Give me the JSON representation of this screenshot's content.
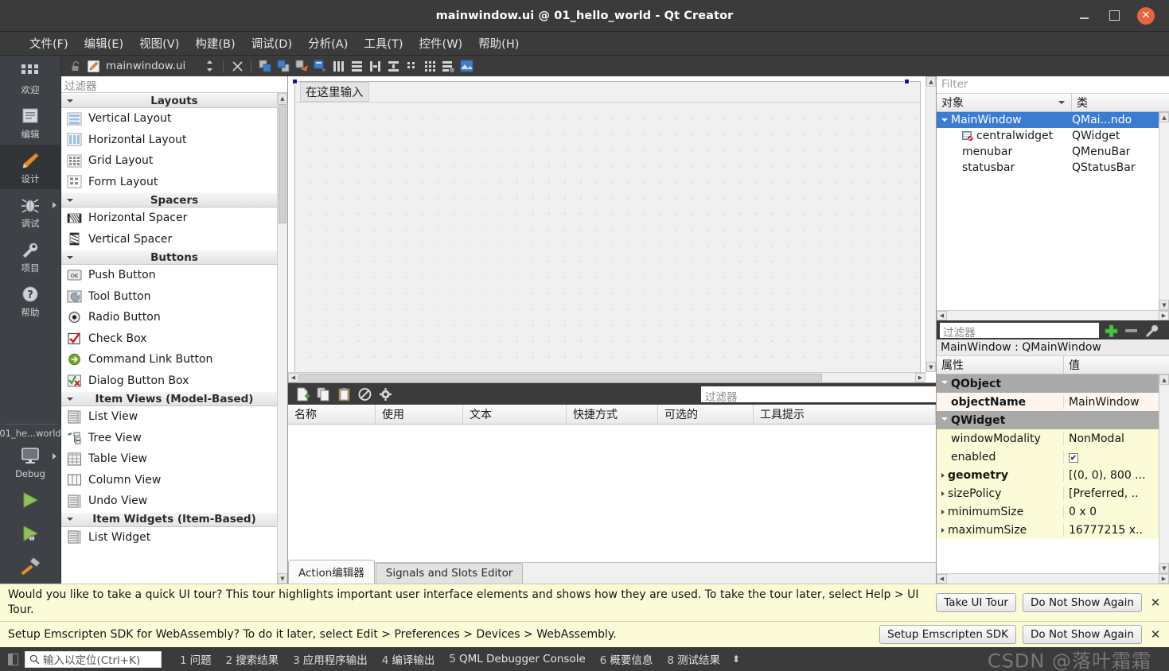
{
  "window": {
    "title": "mainwindow.ui @ 01_hello_world - Qt Creator",
    "minimize_label": "—",
    "maximize_label": "□",
    "close_label": "✕"
  },
  "menubar": {
    "items": [
      {
        "label": "文件(F)"
      },
      {
        "label": "编辑(E)"
      },
      {
        "label": "视图(V)"
      },
      {
        "label": "构建(B)"
      },
      {
        "label": "调试(D)"
      },
      {
        "label": "分析(A)"
      },
      {
        "label": "工具(T)"
      },
      {
        "label": "控件(W)"
      },
      {
        "label": "帮助(H)"
      }
    ]
  },
  "modebar": {
    "modes": [
      {
        "label": "欢迎",
        "icon": "grid-icon",
        "active": false,
        "arrow": false
      },
      {
        "label": "编辑",
        "icon": "document-icon",
        "active": false,
        "arrow": false
      },
      {
        "label": "设计",
        "icon": "pencil-icon",
        "active": true,
        "arrow": false
      },
      {
        "label": "调试",
        "icon": "bug-icon",
        "active": false,
        "arrow": true
      },
      {
        "label": "项目",
        "icon": "wrench-icon",
        "active": false,
        "arrow": false
      },
      {
        "label": "帮助",
        "icon": "question-icon",
        "active": false,
        "arrow": false
      }
    ],
    "project_name": "01_he...world",
    "kit_label": "Debug",
    "run_label": "run-icon",
    "debug_label": "debug-run-icon",
    "build_label": "hammer-icon"
  },
  "editor": {
    "tab_name": "mainwindow.ui",
    "lock_icon": "lock-icon",
    "file_icon": "ui-file-icon",
    "toolbar_icons": [
      "split-updown-icon",
      "close-editor-icon",
      "send-to-back-icon",
      "bring-to-front-icon",
      "adjust-size-icon",
      "break-layout-icon",
      "horizontal-layout-icon",
      "vertical-layout-icon",
      "splitter-h-icon",
      "splitter-v-icon",
      "form-layout-icon",
      "grid-layout-icon",
      "layout-list-icon",
      "preview-icon"
    ]
  },
  "widget_box": {
    "filter_placeholder": "过滤器",
    "groups": [
      {
        "title": "Layouts",
        "items": [
          {
            "label": "Vertical Layout",
            "icon": "vertical-layout-icon"
          },
          {
            "label": "Horizontal Layout",
            "icon": "horizontal-layout-icon"
          },
          {
            "label": "Grid Layout",
            "icon": "grid-layout-icon"
          },
          {
            "label": "Form Layout",
            "icon": "form-layout-icon"
          }
        ]
      },
      {
        "title": "Spacers",
        "items": [
          {
            "label": "Horizontal Spacer",
            "icon": "horizontal-spacer-icon"
          },
          {
            "label": "Vertical Spacer",
            "icon": "vertical-spacer-icon"
          }
        ]
      },
      {
        "title": "Buttons",
        "items": [
          {
            "label": "Push Button",
            "icon": "push-button-icon"
          },
          {
            "label": "Tool Button",
            "icon": "tool-button-icon"
          },
          {
            "label": "Radio Button",
            "icon": "radio-button-icon"
          },
          {
            "label": "Check Box",
            "icon": "check-box-icon"
          },
          {
            "label": "Command Link Button",
            "icon": "command-link-icon"
          },
          {
            "label": "Dialog Button Box",
            "icon": "dialog-button-box-icon"
          }
        ]
      },
      {
        "title": "Item Views (Model-Based)",
        "items": [
          {
            "label": "List View",
            "icon": "list-view-icon"
          },
          {
            "label": "Tree View",
            "icon": "tree-view-icon"
          },
          {
            "label": "Table View",
            "icon": "table-view-icon"
          },
          {
            "label": "Column View",
            "icon": "column-view-icon"
          },
          {
            "label": "Undo View",
            "icon": "undo-view-icon"
          }
        ]
      },
      {
        "title": "Item Widgets (Item-Based)",
        "items": [
          {
            "label": "List Widget",
            "icon": "list-widget-icon"
          }
        ]
      }
    ]
  },
  "canvas": {
    "menubar_placeholder": "在这里输入"
  },
  "action_editor": {
    "toolbar_icons": [
      "new-action-icon",
      "copy-icon",
      "paste-icon",
      "delete-icon",
      "settings-icon"
    ],
    "filter_placeholder": "过滤器",
    "columns": [
      "名称",
      "使用",
      "文本",
      "快捷方式",
      "可选的",
      "工具提示"
    ],
    "rows": [],
    "tabs": [
      {
        "label": "Action编辑器",
        "active": true
      },
      {
        "label": "Signals and Slots Editor",
        "active": false
      }
    ]
  },
  "object_inspector": {
    "filter_placeholder": "Filter",
    "columns": [
      "对象",
      "类"
    ],
    "rows": [
      {
        "name": "MainWindow",
        "class": "QMai...ndo",
        "indent": 0,
        "expander": true,
        "selected": true,
        "icon": ""
      },
      {
        "name": "centralwidget",
        "class": "QWidget",
        "indent": 2,
        "expander": false,
        "selected": false,
        "icon": "central-widget-icon"
      },
      {
        "name": "menubar",
        "class": "QMenuBar",
        "indent": 2,
        "expander": false,
        "selected": false,
        "icon": ""
      },
      {
        "name": "statusbar",
        "class": "QStatusBar",
        "indent": 2,
        "expander": false,
        "selected": false,
        "icon": ""
      }
    ]
  },
  "property_editor": {
    "filter_placeholder": "过滤器",
    "add_icon": "plus-icon",
    "remove_icon": "minus-icon",
    "config_icon": "wrench-icon",
    "subject": "MainWindow : QMainWindow",
    "columns": [
      "属性",
      "值"
    ],
    "rows": [
      {
        "key": "QObject",
        "value": "",
        "type": "group"
      },
      {
        "key": "objectName",
        "value": "MainWindow",
        "type": "alt",
        "bold": true
      },
      {
        "key": "QWidget",
        "value": "",
        "type": "group"
      },
      {
        "key": "windowModality",
        "value": "NonModal",
        "type": "yel"
      },
      {
        "key": "enabled",
        "value": "✔",
        "type": "yel",
        "checkbox": true
      },
      {
        "key": "geometry",
        "value": "[(0, 0), 800 ...",
        "type": "yel",
        "bold": true,
        "expander": true
      },
      {
        "key": "sizePolicy",
        "value": "[Preferred, ..",
        "type": "yel",
        "expander": true
      },
      {
        "key": "minimumSize",
        "value": "0 x 0",
        "type": "yel",
        "expander": true
      },
      {
        "key": "maximumSize",
        "value": "16777215 x..",
        "type": "yel",
        "expander": true
      }
    ]
  },
  "notifications": [
    {
      "text": "Would you like to take a quick UI tour? This tour highlights important user interface elements and shows how they are used. To take the tour later, select Help > UI Tour.",
      "buttons": [
        "Take UI Tour",
        "Do Not Show Again"
      ],
      "close": "✕"
    },
    {
      "text": "Setup Emscripten SDK for WebAssembly? To do it later, select Edit > Preferences > Devices > WebAssembly.",
      "buttons": [
        "Setup Emscripten SDK",
        "Do Not Show Again"
      ],
      "close": "✕"
    }
  ],
  "statusbar": {
    "locator_placeholder": "输入以定位(Ctrl+K)",
    "locator_icon": "search-icon",
    "items": [
      {
        "num": "1",
        "label": "问题"
      },
      {
        "num": "2",
        "label": "搜索结果"
      },
      {
        "num": "3",
        "label": "应用程序输出"
      },
      {
        "num": "4",
        "label": "编译输出"
      },
      {
        "num": "5",
        "label": "QML Debugger Console"
      },
      {
        "num": "6",
        "label": "概要信息"
      },
      {
        "num": "8",
        "label": "测试结果"
      }
    ],
    "updown": "⬍",
    "watermark": "CSDN @落叶霜霜"
  },
  "colors": {
    "accent_selection": "#3b7cd3",
    "dark_chrome": "#3b3b3b",
    "modebar": "#3e4145",
    "close_button": "#e8643c",
    "notification_bg": "#fbfbd7",
    "property_yellow": "#fbfbd7",
    "property_group": "#a9a9a9",
    "handle_blue": "#10158c"
  }
}
